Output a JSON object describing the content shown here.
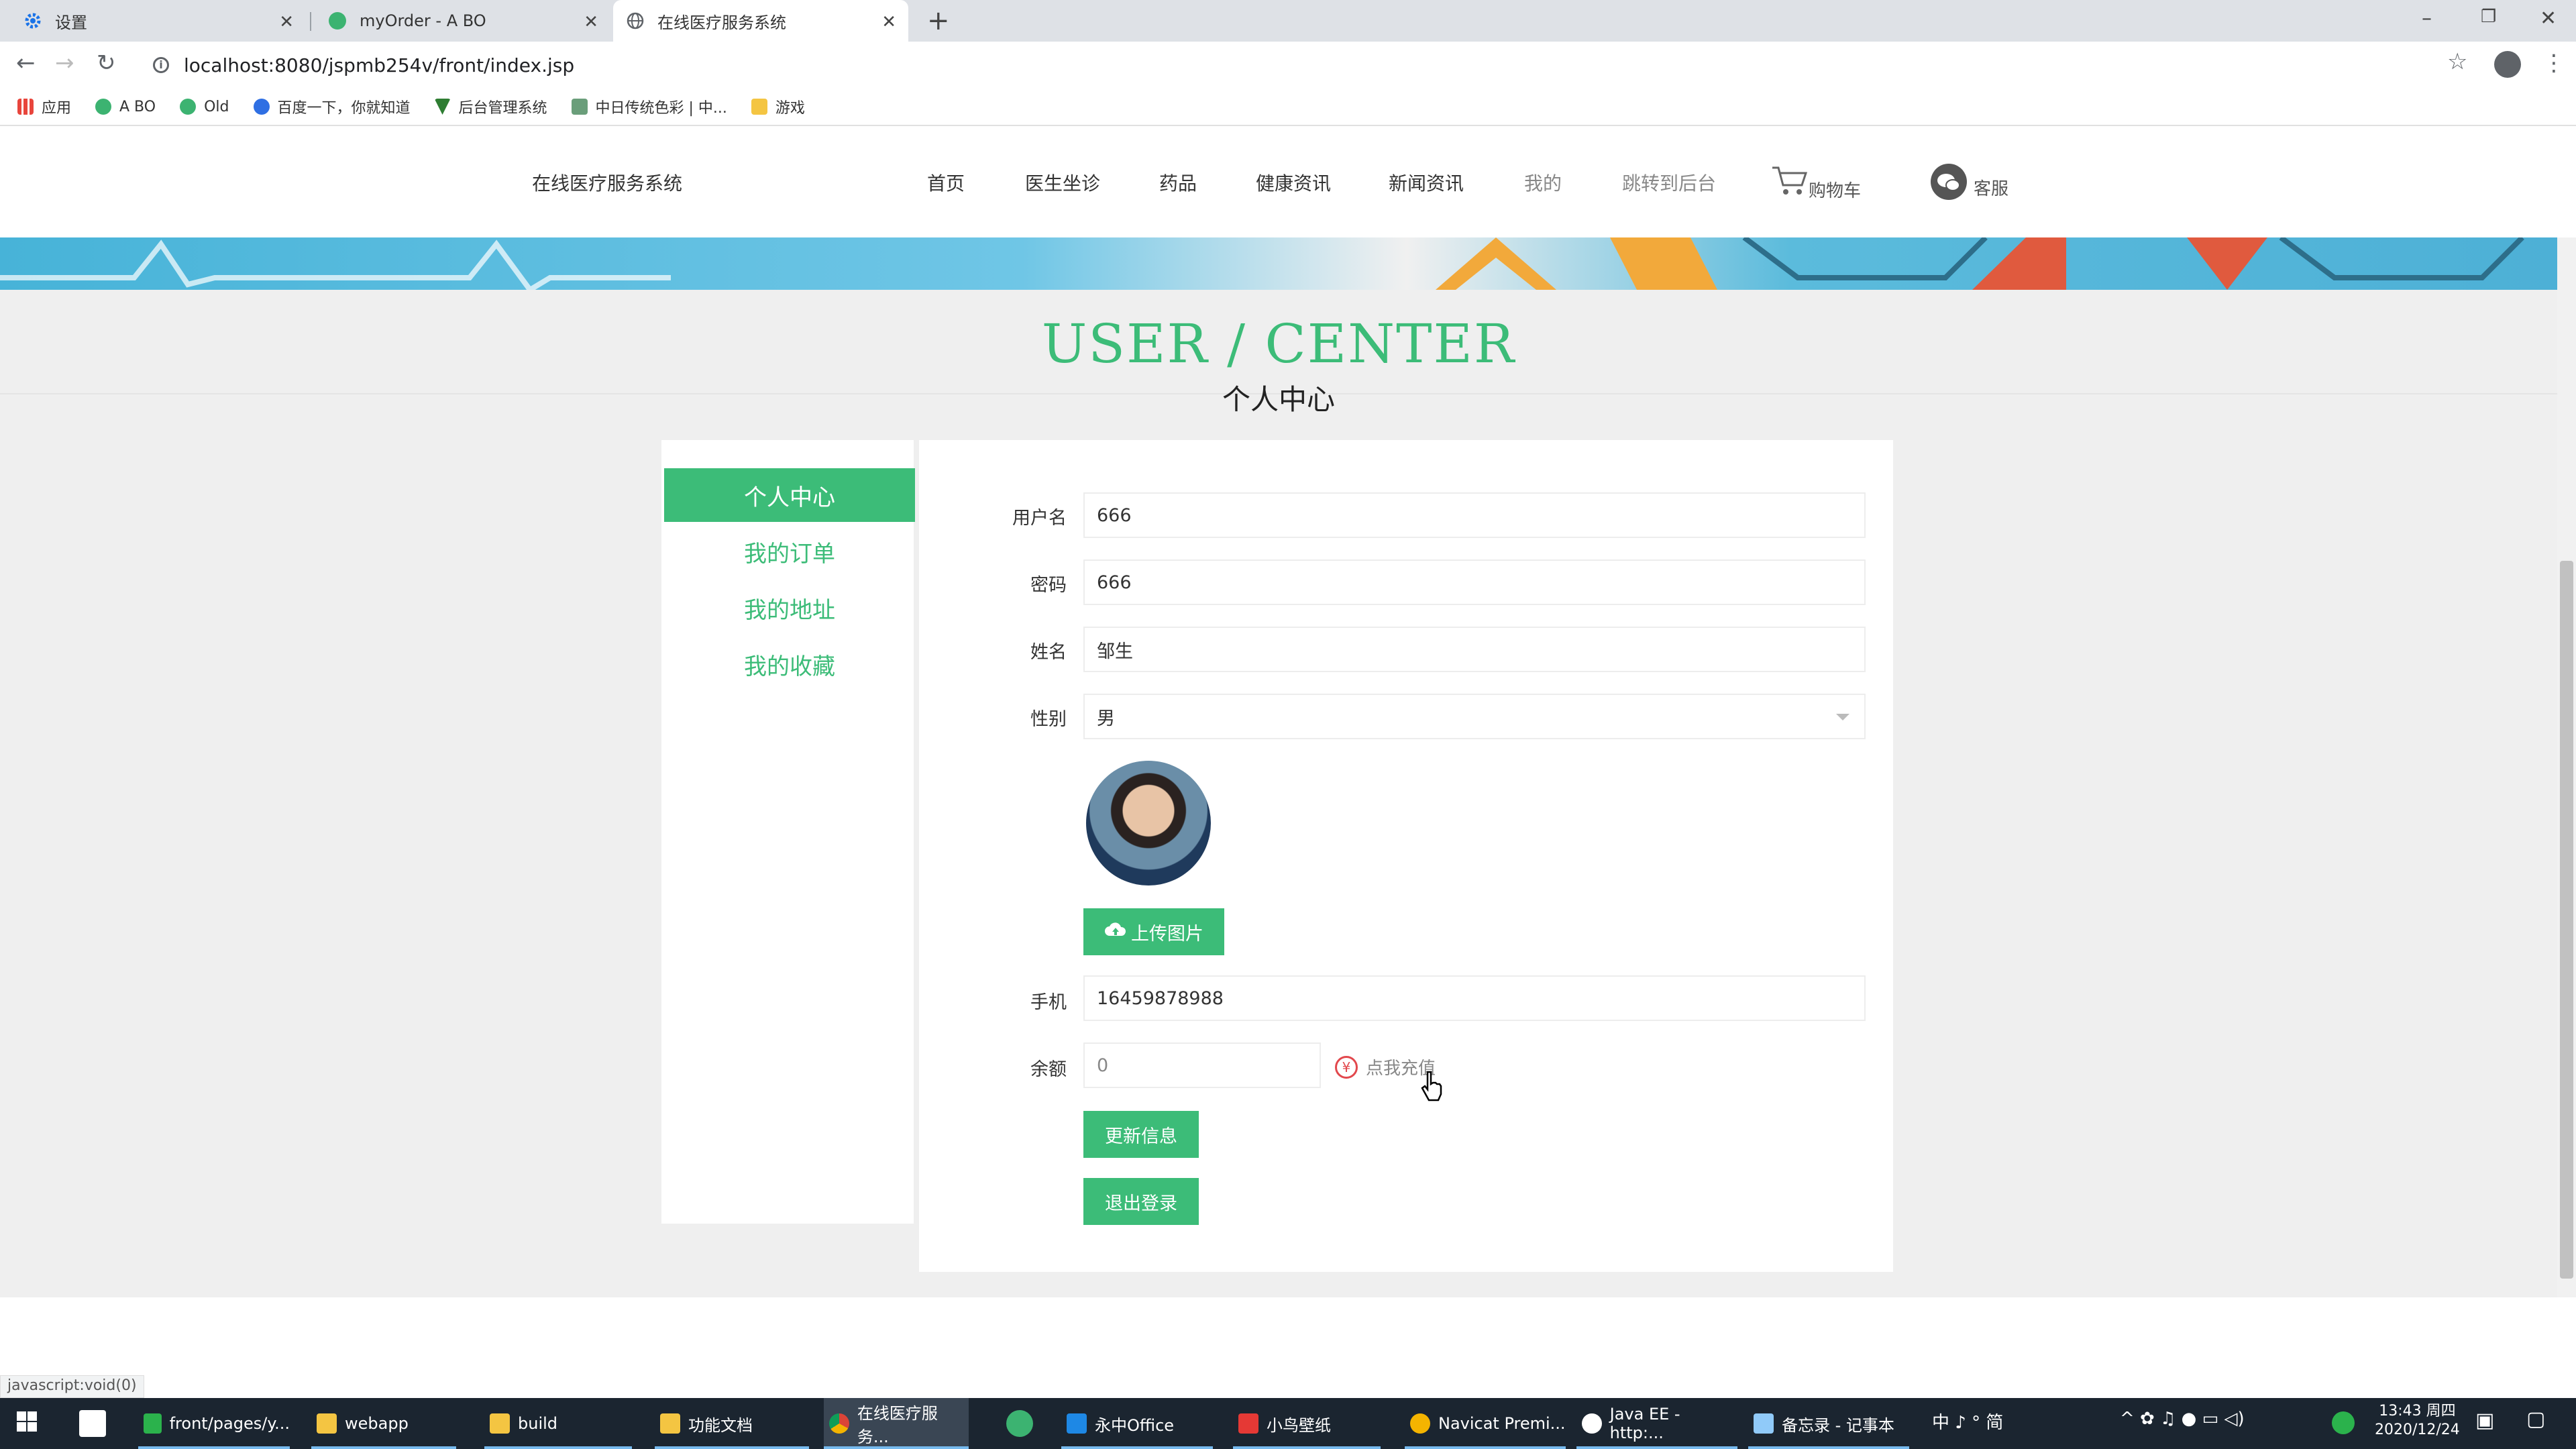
{
  "browser": {
    "tabs": [
      {
        "label": "设置"
      },
      {
        "label": "myOrder - A BO"
      },
      {
        "label": "在线医疗服务系统"
      }
    ],
    "url": "localhost:8080/jspmb254v/front/index.jsp",
    "bookmarks": [
      {
        "label": "应用"
      },
      {
        "label": "A BO"
      },
      {
        "label": "Old"
      },
      {
        "label": "百度一下，你就知道"
      },
      {
        "label": "后台管理系统"
      },
      {
        "label": "中日传统色彩 | 中..."
      },
      {
        "label": "游戏"
      }
    ],
    "status_text": "javascript:void(0)"
  },
  "site": {
    "brand": "在线医疗服务系统",
    "nav": [
      "首页",
      "医生坐诊",
      "药品",
      "健康资讯",
      "新闻资讯",
      "我的",
      "跳转到后台"
    ],
    "cart_label": "购物车",
    "service_label": "客服",
    "title_en": "USER / CENTER",
    "title_cn": "个人中心"
  },
  "sidebar": {
    "items": [
      {
        "label": "个人中心",
        "active": true
      },
      {
        "label": "我的订单"
      },
      {
        "label": "我的地址"
      },
      {
        "label": "我的收藏"
      }
    ]
  },
  "form": {
    "username": {
      "label": "用户名",
      "value": "666"
    },
    "password": {
      "label": "密码",
      "value": "666"
    },
    "name": {
      "label": "姓名",
      "value": "邹生"
    },
    "gender": {
      "label": "性别",
      "value": "男"
    },
    "upload_label": "上传图片",
    "phone": {
      "label": "手机",
      "value": "16459878988"
    },
    "balance": {
      "label": "余额",
      "value": "0"
    },
    "recharge_symbol": "¥",
    "recharge_label": "点我充值",
    "update_button": "更新信息",
    "logout_button": "退出登录"
  },
  "taskbar": {
    "items": [
      {
        "label": "front/pages/y..."
      },
      {
        "label": "webapp"
      },
      {
        "label": "build"
      },
      {
        "label": "功能文档"
      },
      {
        "label": "在线医疗服务..."
      },
      {
        "label": "永中Office"
      },
      {
        "label": "小鸟壁纸"
      },
      {
        "label": "Navicat Premi..."
      },
      {
        "label": "Java EE - http:..."
      },
      {
        "label": "备忘录 - 记事本"
      }
    ],
    "tray_text": "中 ♪ ° 简",
    "time": "13:43 周四",
    "date": "2020/12/24"
  },
  "colors": {
    "accent": "#3cbc78",
    "recharge_red": "#e2484d"
  }
}
